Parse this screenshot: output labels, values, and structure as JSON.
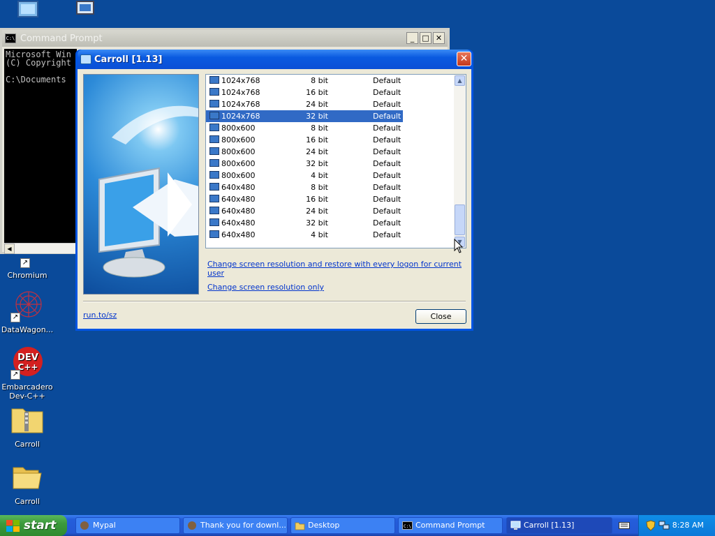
{
  "desktop": {
    "icons": [
      {
        "label": "Chromium"
      },
      {
        "label": "DataWagon..."
      },
      {
        "label": "Embarcadero Dev-C++"
      },
      {
        "label": "Carroll"
      },
      {
        "label": "Carroll"
      }
    ]
  },
  "cmd": {
    "title": "Command Prompt",
    "lines": [
      "Microsoft Win",
      "(C) Copyright",
      "",
      "C:\\Documents"
    ]
  },
  "carroll": {
    "title": "Carroll [1.13]",
    "rows": [
      {
        "res": "1024x768",
        "bits": "8 bit",
        "freq": "Default"
      },
      {
        "res": "1024x768",
        "bits": "16 bit",
        "freq": "Default"
      },
      {
        "res": "1024x768",
        "bits": "24 bit",
        "freq": "Default"
      },
      {
        "res": "1024x768",
        "bits": "32 bit",
        "freq": "Default"
      },
      {
        "res": "800x600",
        "bits": "8 bit",
        "freq": "Default"
      },
      {
        "res": "800x600",
        "bits": "16 bit",
        "freq": "Default"
      },
      {
        "res": "800x600",
        "bits": "24 bit",
        "freq": "Default"
      },
      {
        "res": "800x600",
        "bits": "32 bit",
        "freq": "Default"
      },
      {
        "res": "800x600",
        "bits": "4 bit",
        "freq": "Default"
      },
      {
        "res": "640x480",
        "bits": "8 bit",
        "freq": "Default"
      },
      {
        "res": "640x480",
        "bits": "16 bit",
        "freq": "Default"
      },
      {
        "res": "640x480",
        "bits": "24 bit",
        "freq": "Default"
      },
      {
        "res": "640x480",
        "bits": "32 bit",
        "freq": "Default"
      },
      {
        "res": "640x480",
        "bits": "4 bit",
        "freq": "Default"
      }
    ],
    "selected_index": 3,
    "link_restore": "Change screen resolution and restore with every logon for current user",
    "link_only": "Change screen resolution only",
    "link_site": "run.to/sz",
    "close_label": "Close"
  },
  "taskbar": {
    "start_label": "start",
    "tasks": [
      {
        "label": "Mypal"
      },
      {
        "label": "Thank you for downl..."
      },
      {
        "label": "Desktop"
      },
      {
        "label": "Command Prompt"
      },
      {
        "label": "Carroll [1.13]"
      }
    ],
    "clock": "8:28 AM"
  },
  "colors": {
    "desktop_bg": "#0a4a9a",
    "selection": "#316ac5",
    "title_bar": "#0054e3",
    "link": "#0033cc"
  }
}
